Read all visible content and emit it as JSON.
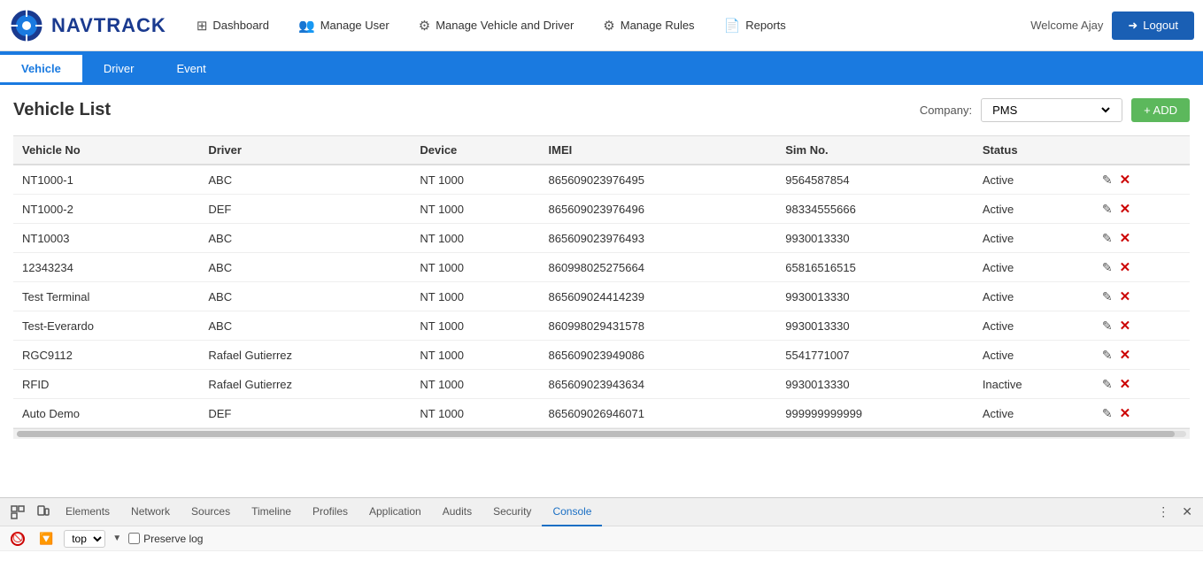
{
  "app": {
    "logo_text": "NAVTRACK",
    "welcome": "Welcome Ajay",
    "logout_label": "Logout"
  },
  "navbar": {
    "dashboard": "Dashboard",
    "manage_user": "Manage User",
    "manage_vehicle": "Manage Vehicle and Driver",
    "manage_rules": "Manage Rules",
    "reports": "Reports"
  },
  "tabs": [
    {
      "id": "vehicle",
      "label": "Vehicle",
      "active": true
    },
    {
      "id": "driver",
      "label": "Driver",
      "active": false
    },
    {
      "id": "event",
      "label": "Event",
      "active": false
    }
  ],
  "page": {
    "title": "Vehicle List",
    "company_label": "Company:",
    "company_value": "PMS",
    "add_button": "+ ADD"
  },
  "table": {
    "headers": [
      "Vehicle No",
      "Driver",
      "Device",
      "IMEI",
      "Sim No.",
      "Status",
      ""
    ],
    "rows": [
      {
        "vehicle_no": "NT1000-1",
        "driver": "ABC",
        "device": "NT 1000",
        "imei": "865609023976495",
        "sim": "9564587854",
        "status": "Active"
      },
      {
        "vehicle_no": "NT1000-2",
        "driver": "DEF",
        "device": "NT 1000",
        "imei": "865609023976496",
        "sim": "98334555666",
        "status": "Active"
      },
      {
        "vehicle_no": "NT10003",
        "driver": "ABC",
        "device": "NT 1000",
        "imei": "865609023976493",
        "sim": "9930013330",
        "status": "Active"
      },
      {
        "vehicle_no": "12343234",
        "driver": "ABC",
        "device": "NT 1000",
        "imei": "860998025275664",
        "sim": "65816516515",
        "status": "Active"
      },
      {
        "vehicle_no": "Test Terminal",
        "driver": "ABC",
        "device": "NT 1000",
        "imei": "865609024414239",
        "sim": "9930013330",
        "status": "Active"
      },
      {
        "vehicle_no": "Test-Everardo",
        "driver": "ABC",
        "device": "NT 1000",
        "imei": "860998029431578",
        "sim": "9930013330",
        "status": "Active"
      },
      {
        "vehicle_no": "RGC9112",
        "driver": "Rafael Gutierrez",
        "device": "NT 1000",
        "imei": "865609023949086",
        "sim": "5541771007",
        "status": "Active"
      },
      {
        "vehicle_no": "RFID",
        "driver": "Rafael Gutierrez",
        "device": "NT 1000",
        "imei": "865609023943634",
        "sim": "9930013330",
        "status": "Inactive"
      },
      {
        "vehicle_no": "Auto Demo",
        "driver": "DEF",
        "device": "NT 1000",
        "imei": "865609026946071",
        "sim": "999999999999",
        "status": "Active"
      }
    ]
  },
  "devtools": {
    "tabs": [
      "Elements",
      "Network",
      "Sources",
      "Timeline",
      "Profiles",
      "Application",
      "Audits",
      "Security",
      "Console"
    ],
    "active_tab": "Console",
    "top_value": "top",
    "preserve_log": "Preserve log"
  },
  "colors": {
    "blue": "#1a7ae0",
    "dark_blue": "#1a3a8f",
    "green": "#5cb85c",
    "red": "#cc0000",
    "active_status": "#333",
    "inactive_status": "#333"
  }
}
